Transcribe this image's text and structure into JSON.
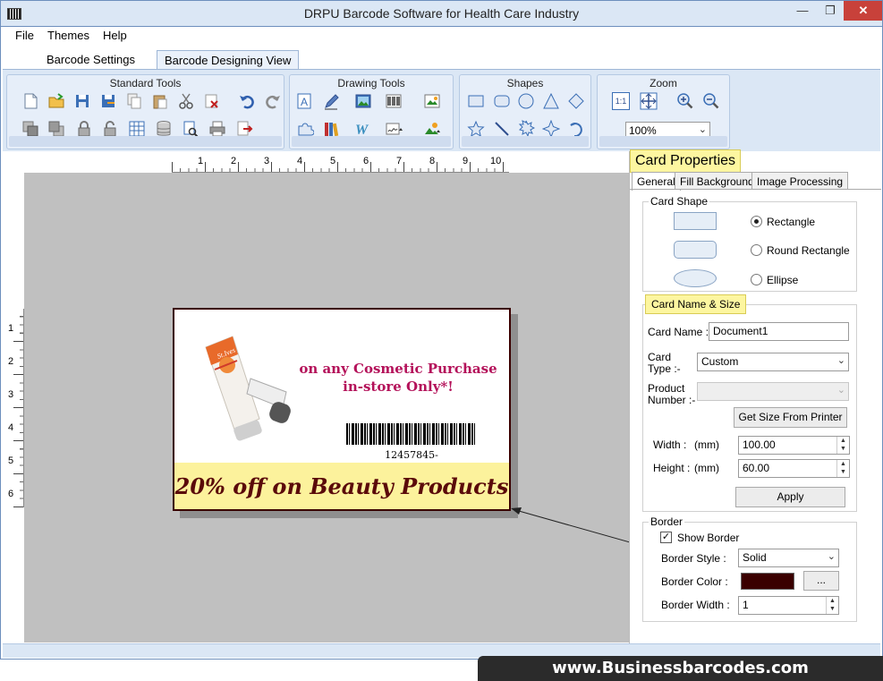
{
  "window": {
    "title": "DRPU Barcode Software for Health Care Industry",
    "min": "—",
    "max": "❐",
    "close": "✕"
  },
  "menu": [
    "File",
    "Themes",
    "Help"
  ],
  "tabs": [
    "Barcode Settings",
    "Barcode Designing View"
  ],
  "ribbon": {
    "standard_tools": "Standard Tools",
    "drawing_tools": "Drawing Tools",
    "shapes": "Shapes",
    "zoom": "Zoom",
    "zoom_value": "100%",
    "zoom_actual_label": "1:1"
  },
  "rulers": {
    "horizontal": [
      "1",
      "2",
      "3",
      "4",
      "5",
      "6",
      "7",
      "8",
      "9",
      "10"
    ],
    "vertical": [
      "1",
      "2",
      "3",
      "4",
      "5",
      "6"
    ]
  },
  "card": {
    "promo_line1": "on any Cosmetic Purchase",
    "promo_line2": "in-store Only*!",
    "barcode_number": "12457845-",
    "banner": "20% off on Beauty Products",
    "product_brand": "St.Ives"
  },
  "props": {
    "title": "Card Properties",
    "tabs": [
      "General",
      "Fill Background",
      "Image Processing"
    ],
    "card_shape_legend": "Card Shape",
    "shapes": [
      "Rectangle",
      "Round Rectangle",
      "Ellipse"
    ],
    "selected_shape": "Rectangle",
    "name_size_title": "Card  Name & Size",
    "card_name_label": "Card Name :",
    "card_name_value": "Document1",
    "card_type_label_1": "Card",
    "card_type_label_2": "Type :-",
    "card_type_value": "Custom",
    "product_number_label_1": "Product",
    "product_number_label_2": "Number :-",
    "get_size_button": "Get Size From Printer",
    "width_label": "Width :",
    "height_label": "Height :",
    "unit": "(mm)",
    "width_value": "100.00",
    "height_value": "60.00",
    "apply_button": "Apply",
    "border_legend": "Border",
    "show_border_label": "Show Border",
    "show_border_checked": true,
    "border_style_label": "Border Style :",
    "border_style_value": "Solid",
    "border_color_label": "Border Color :",
    "border_color": "#3a0000",
    "border_color_button": "...",
    "border_width_label": "Border Width :",
    "border_width_value": "1"
  },
  "footer": "www.Businessbarcodes.com"
}
